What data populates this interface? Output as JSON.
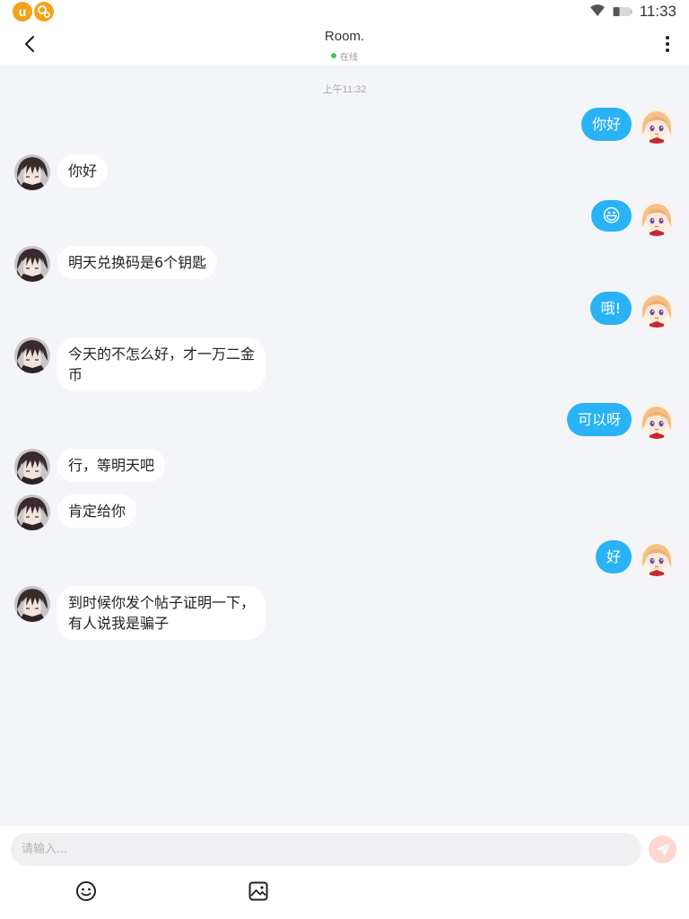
{
  "status_bar": {
    "time": "11:33",
    "app_badge_letter": "u",
    "icons": [
      "app-u-icon",
      "app-gear-icon",
      "wifi-icon",
      "battery-icon"
    ]
  },
  "header": {
    "title": "Room.",
    "status": "在线",
    "icons": [
      "back-arrow-icon",
      "more-vertical-icon"
    ],
    "colors": {
      "online": "#3cc45a"
    }
  },
  "chat": {
    "timestamp": "上午11:32",
    "colors": {
      "outgoing_bubble": "#29b3f6",
      "incoming_bubble": "#ffffff"
    },
    "messages": [
      {
        "from": "me",
        "text": "你好"
      },
      {
        "from": "other",
        "text": "你好"
      },
      {
        "from": "me",
        "text": "😃",
        "type": "emoji"
      },
      {
        "from": "other",
        "text": "明天兑换码是6个钥匙"
      },
      {
        "from": "me",
        "text": "哦!"
      },
      {
        "from": "other",
        "text": "今天的不怎么好，才一万二金币"
      },
      {
        "from": "me",
        "text": "可以呀"
      },
      {
        "from": "other",
        "text": "行，等明天吧"
      },
      {
        "from": "other",
        "text": "肯定给你"
      },
      {
        "from": "me",
        "text": "好"
      },
      {
        "from": "other",
        "text": "到时候你发个帖子证明一下，有人说我是骗子"
      }
    ]
  },
  "input_bar": {
    "placeholder": "请输入...",
    "value": "",
    "icons": [
      "send-icon",
      "emoji-icon",
      "image-icon"
    ],
    "colors": {
      "send_button": "#ffd6d2"
    }
  }
}
